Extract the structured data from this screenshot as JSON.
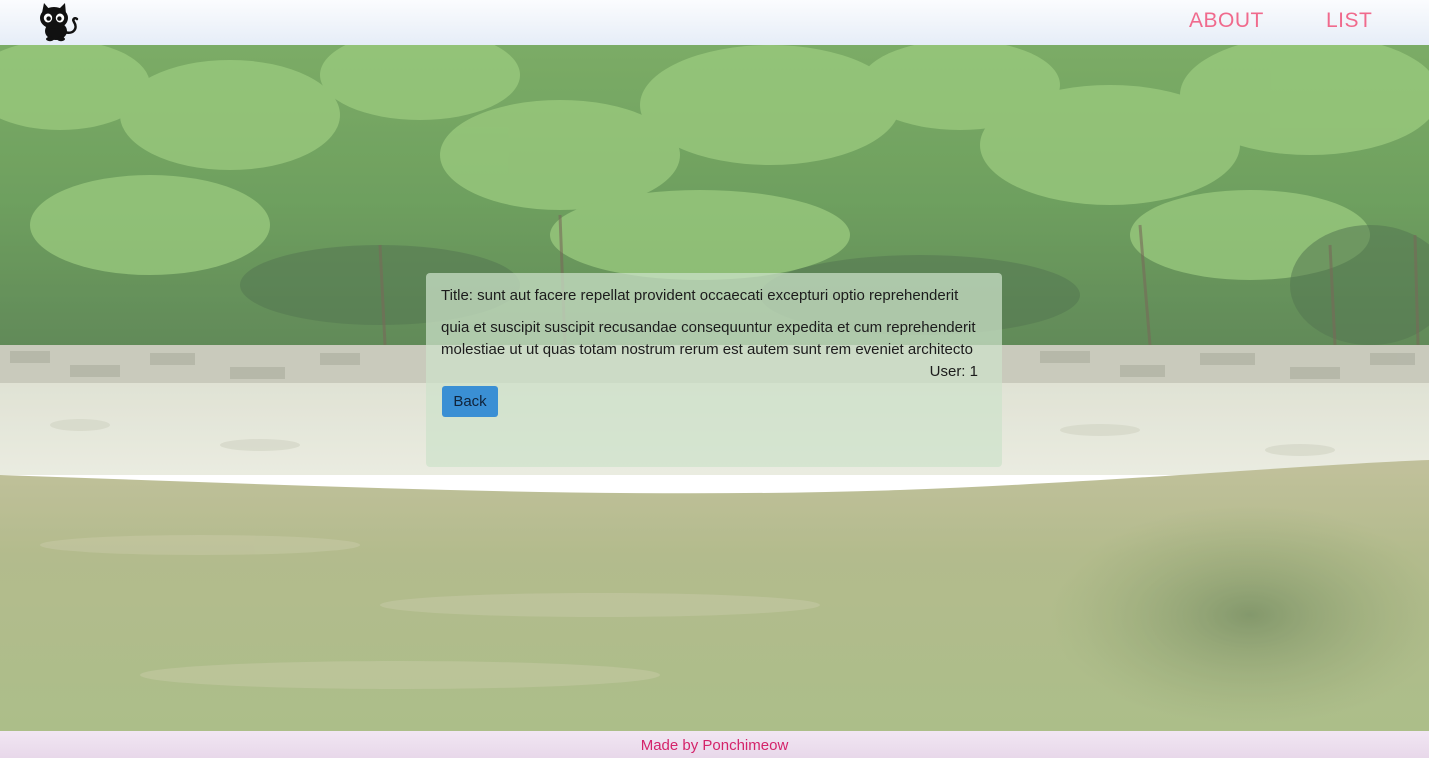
{
  "header": {
    "logo_icon": "black-cat-icon",
    "nav": [
      {
        "label": "ABOUT"
      },
      {
        "label": "LIST"
      }
    ],
    "nav_color": "#f06a8d"
  },
  "post": {
    "title": "Title: sunt aut facere repellat provident occaecati excepturi optio reprehenderit",
    "body": "quia et suscipit suscipit recusandae consequuntur expedita et cum reprehenderit molestiae ut ut quas totam nostrum rerum est autem sunt rem eveniet architecto",
    "user": "User: 1",
    "back_label": "Back"
  },
  "footer": {
    "text": "Made by Ponchimeow",
    "color": "#d4236a"
  }
}
